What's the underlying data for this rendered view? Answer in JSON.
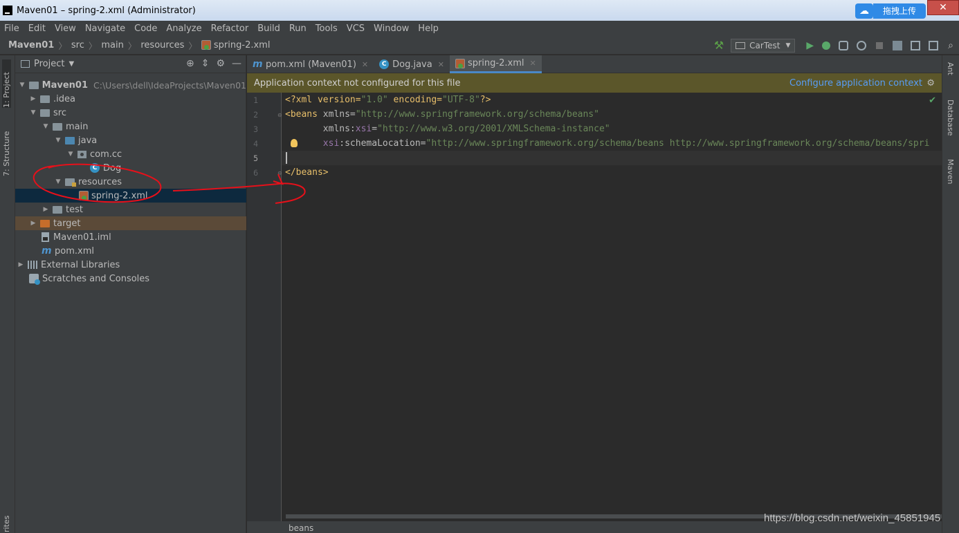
{
  "window": {
    "title": "Maven01 – spring-2.xml (Administrator)",
    "upload_label": "拖拽上传",
    "close_glyph": "✕"
  },
  "menu": [
    "File",
    "Edit",
    "View",
    "Navigate",
    "Code",
    "Analyze",
    "Refactor",
    "Build",
    "Run",
    "Tools",
    "VCS",
    "Window",
    "Help"
  ],
  "breadcrumb": {
    "project": "Maven01",
    "src": "src",
    "main": "main",
    "resources": "resources",
    "file": "spring-2.xml"
  },
  "toolbar": {
    "run_config": "CarTest"
  },
  "left_tabs": {
    "project": "1: Project",
    "structure": "7: Structure",
    "favorites": "rites"
  },
  "right_tabs": {
    "ant": "Ant",
    "database": "Database",
    "maven": "Maven"
  },
  "project_panel": {
    "header": "Project",
    "tree": {
      "root": "Maven01",
      "root_path": "C:\\Users\\dell\\IdeaProjects\\Maven01",
      "idea": ".idea",
      "src": "src",
      "main": "main",
      "java": "java",
      "package": "com.cc",
      "dog": "Dog",
      "resources": "resources",
      "spring_file": "spring-2.xml",
      "test": "test",
      "target": "target",
      "iml": "Maven01.iml",
      "pom": "pom.xml",
      "ext_libs": "External Libraries",
      "scratches": "Scratches and Consoles"
    }
  },
  "editor": {
    "tabs": [
      {
        "label": "pom.xml (Maven01)",
        "active": false
      },
      {
        "label": "Dog.java",
        "active": false
      },
      {
        "label": "spring-2.xml",
        "active": true
      }
    ],
    "banner": "Application context not configured for this file",
    "banner_action": "Configure application context",
    "line_numbers": [
      "1",
      "2",
      "3",
      "4",
      "5",
      "6"
    ],
    "current_line": 5,
    "code": {
      "l1_a": "<?xml version=",
      "l1_b": "\"1.0\"",
      "l1_c": " encoding=",
      "l1_d": "\"UTF-8\"",
      "l1_e": "?>",
      "l2_a": "<beans ",
      "l2_b": "xmlns=",
      "l2_c": "\"http://www.springframework.org/schema/beans\"",
      "l3_a": "       xmlns:",
      "l3_b": "xsi",
      "l3_c": "=",
      "l3_d": "\"http://www.w3.org/2001/XMLSchema-instance\"",
      "l4_a": "       ",
      "l4_b": "xsi",
      "l4_c": ":schemaLocation=",
      "l4_d": "\"http://www.springframework.org/schema/beans http://www.springframework.org/schema/beans/spri",
      "l6_a": "</beans>"
    },
    "status_crumb": "beans"
  },
  "watermark": "https://blog.csdn.net/weixin_45851945",
  "colors": {
    "background": "#2b2b2b",
    "panel": "#3c3f41",
    "selection": "#0d293e",
    "annotation": "#e8101a",
    "banner": "#5b562a",
    "link": "#589df6"
  }
}
